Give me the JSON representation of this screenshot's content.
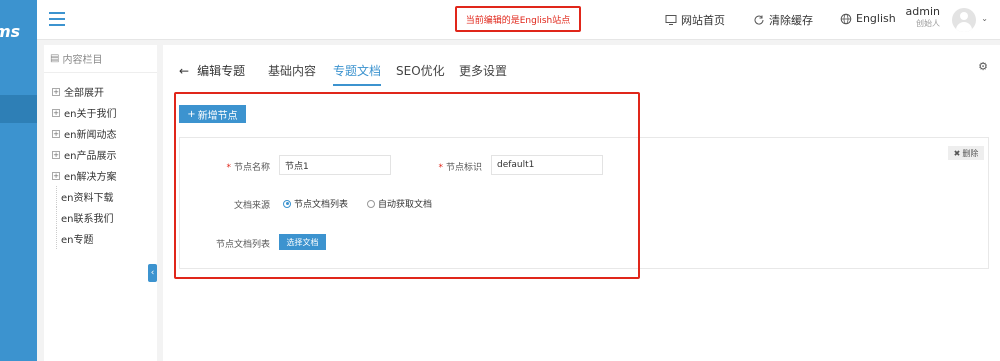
{
  "brand": {
    "logo_text": "ms"
  },
  "header": {
    "site_notice": "当前编辑的是English站点",
    "links": {
      "site_home": "网站首页",
      "clear_cache": "清除缓存",
      "language": "English"
    },
    "user": {
      "name": "admin",
      "role": "创始人"
    }
  },
  "column_panel": {
    "title": "内容栏目",
    "items": [
      {
        "label": "全部展开",
        "expandable": true
      },
      {
        "label": "en关于我们",
        "expandable": true
      },
      {
        "label": "en新闻动态",
        "expandable": true
      },
      {
        "label": "en产品展示",
        "expandable": true
      },
      {
        "label": "en解决方案",
        "expandable": true
      },
      {
        "label": "en资料下载",
        "expandable": false
      },
      {
        "label": "en联系我们",
        "expandable": false
      },
      {
        "label": "en专题",
        "expandable": false
      }
    ],
    "collapse_icon": "chevron-left-icon"
  },
  "main": {
    "back_label": "编辑专题",
    "tabs": [
      {
        "label": "基础内容"
      },
      {
        "label": "专题文档",
        "active": true
      },
      {
        "label": "SEO优化"
      },
      {
        "label": "更多设置"
      }
    ],
    "add_node_label": "新增节点",
    "delete_label": "删除",
    "form": {
      "node_name_label": "节点名称",
      "node_name_value": "节点1",
      "node_id_label": "节点标识",
      "node_id_value": "default1",
      "doc_source_label": "文档来源",
      "doc_source_options": [
        "节点文档列表",
        "自动获取文档"
      ],
      "doc_source_selected": "节点文档列表",
      "doc_list_label": "节点文档列表",
      "select_doc_label": "选择文档"
    }
  },
  "colors": {
    "accent": "#3c93cf",
    "highlight": "#e0261a"
  }
}
